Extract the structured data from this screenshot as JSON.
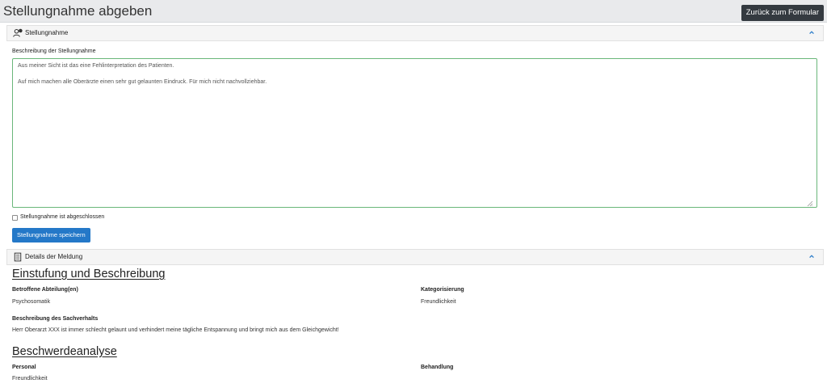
{
  "header": {
    "title": "Stellungnahme abgeben",
    "back_button": "Zurück zum Formular"
  },
  "statement_panel": {
    "title": "Stellungnahme",
    "icon": "user-comment-icon",
    "description_label": "Beschreibung der Stellungnahme",
    "description_value": "Aus meiner Sicht ist das eine Fehlinterpretation des Patienten.\n\nAuf mich machen alle Oberärzte einen sehr gut gelaunten Eindruck. Für mich nicht nachvollziehbar.",
    "checkbox_label": "Stellungnahme ist abgeschlossen",
    "checkbox_checked": false,
    "save_button": "Stellungnahme speichern"
  },
  "details_panel": {
    "title": "Details der Meldung",
    "icon": "document-icon",
    "classification": {
      "heading": "Einstufung und Beschreibung",
      "department_label": "Betroffene Abteilung(en)",
      "department_value": "Psychosomatik",
      "category_label": "Kategorisierung",
      "category_value": "Freundlichkeit",
      "facts_label": "Beschreibung des Sachverhalts",
      "facts_value": "Herr Oberarzt XXX ist immer schlecht gelaunt und verhindert meine tägliche Entspannung und bringt mich aus dem Gleichgewicht!"
    },
    "analysis": {
      "heading": "Beschwerdeanalyse",
      "personnel_label": "Personal",
      "personnel_value": "Freundlichkeit",
      "treatment_label": "Behandlung"
    }
  },
  "colors": {
    "accent": "#2478c8",
    "dark_button": "#343a40",
    "textarea_focus_border": "#6ab77a",
    "chevron": "#2478c8"
  }
}
